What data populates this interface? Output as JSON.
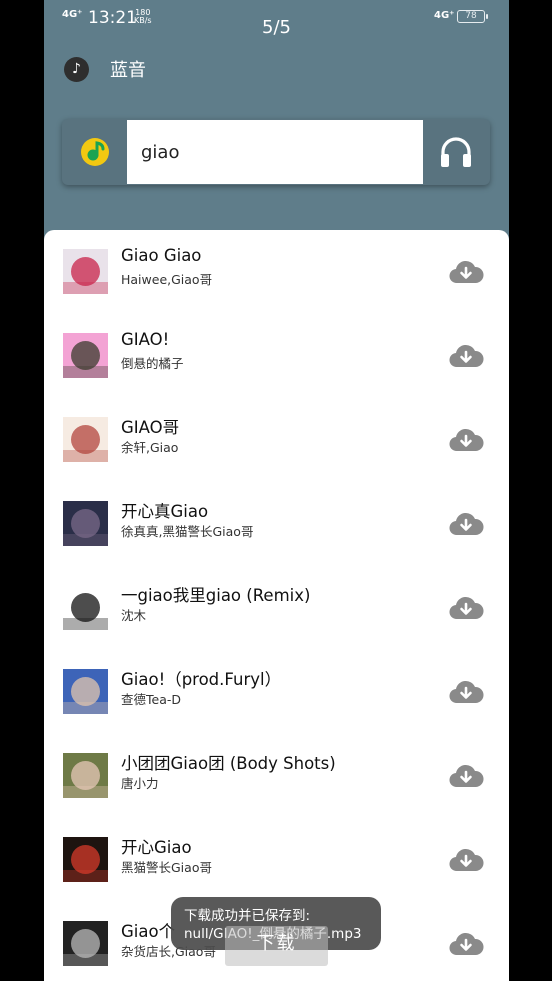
{
  "status_bar": {
    "signal_left": "4G⁺",
    "time": "13:21",
    "net_speed_value": "180",
    "net_speed_unit": "KB/s",
    "signal_right": "4G⁺",
    "battery": "78"
  },
  "page_indicator": "5/5",
  "app": {
    "name": "蓝音",
    "icon": "music-note-icon"
  },
  "search": {
    "source_icon": "qq-music-icon",
    "query": "giao",
    "action_icon": "headphones-icon"
  },
  "songs": [
    {
      "title": "Giao Giao",
      "artist": "Haiwee,Giao哥",
      "cover_colors": [
        "#e9e2ea",
        "#c8234a"
      ]
    },
    {
      "title": "GIAO!",
      "artist": "倒悬的橘子",
      "cover_colors": [
        "#f3a3d4",
        "#3b3b2e"
      ]
    },
    {
      "title": "GIAO哥",
      "artist": "余轩,Giao",
      "cover_colors": [
        "#f6ebe2",
        "#b3463d"
      ]
    },
    {
      "title": "开心真Giao",
      "artist": "徐真真,黑猫警长Giao哥",
      "cover_colors": [
        "#2a2e48",
        "#7a6a88"
      ]
    },
    {
      "title": "一giao我里giao (Remix)",
      "artist": "沈木",
      "cover_colors": [
        "#ffffff",
        "#111111"
      ]
    },
    {
      "title": "Giao!（prod.Furyl）",
      "artist": "查德Tea-D",
      "cover_colors": [
        "#3d64b8",
        "#e2c6ad"
      ]
    },
    {
      "title": "小团团Giao团 (Body Shots)",
      "artist": "唐小力",
      "cover_colors": [
        "#6e7a46",
        "#e7c8b8"
      ]
    },
    {
      "title": "开心Giao",
      "artist": "黑猫警长Giao哥",
      "cover_colors": [
        "#1e1410",
        "#d53a2a"
      ]
    },
    {
      "title": "Giao个",
      "artist": "杂货店长,Giao哥",
      "cover_colors": [
        "#222222",
        "#bbbbbb"
      ]
    }
  ],
  "toast": {
    "line1": "下载成功并已保存到:",
    "line2": "null/GIAO!_倒悬的橘子.mp3"
  },
  "download_label": "下载",
  "colors": {
    "header_bg": "#5f7d8a",
    "icon_gray": "#8a8a8a"
  }
}
